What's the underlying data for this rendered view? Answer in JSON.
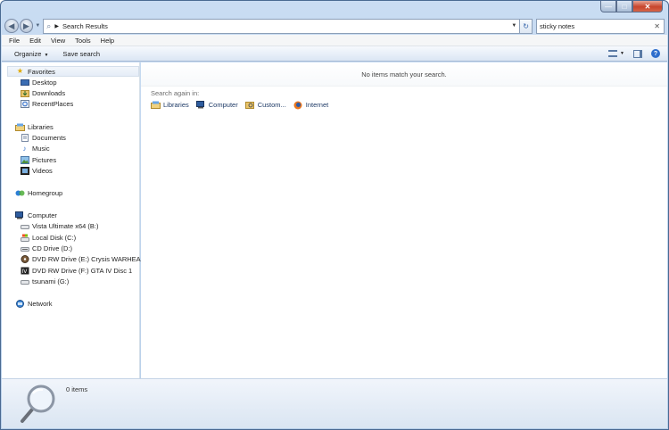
{
  "window": {
    "close_glyph": "✕",
    "maximize_glyph": "□",
    "minimize_glyph": "—"
  },
  "address": {
    "path": "Search Results"
  },
  "search": {
    "value": "sticky notes"
  },
  "menu": [
    "File",
    "Edit",
    "View",
    "Tools",
    "Help"
  ],
  "commands": {
    "organize": "Organize",
    "save_search": "Save search"
  },
  "nav": {
    "favorites": {
      "label": "Favorites",
      "items": [
        "Desktop",
        "Downloads",
        "RecentPlaces"
      ]
    },
    "libraries": {
      "label": "Libraries",
      "items": [
        "Documents",
        "Music",
        "Pictures",
        "Videos"
      ]
    },
    "homegroup": {
      "label": "Homegroup"
    },
    "computer": {
      "label": "Computer",
      "items": [
        "Vista Ultimate x64 (B:)",
        "Local Disk (C:)",
        "CD Drive (D:)",
        "DVD RW Drive (E:) Crysis WARHEAD(R)",
        "DVD RW Drive (F:) GTA IV Disc 1",
        "tsunami (G:)"
      ]
    },
    "network": {
      "label": "Network"
    }
  },
  "content": {
    "empty_message": "No items match your search.",
    "search_again_label": "Search again in:",
    "search_again": [
      "Libraries",
      "Computer",
      "Custom...",
      "Internet"
    ]
  },
  "details": {
    "count": "0 items"
  },
  "colors": {
    "accent": "#2d6dcc",
    "frame": "#b8cfe9"
  }
}
